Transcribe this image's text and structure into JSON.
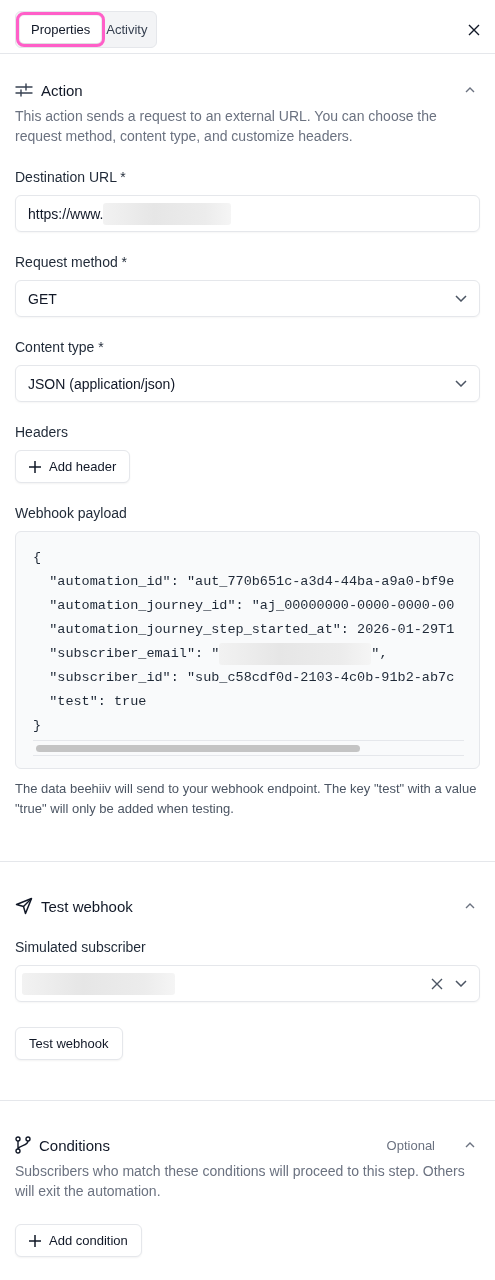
{
  "tabs": [
    {
      "label": "Properties",
      "selected": true,
      "highlighted": true
    },
    {
      "label": "Activity",
      "selected": false,
      "highlighted": false
    }
  ],
  "sections": [
    {
      "kind": "action",
      "title": "Action",
      "expanded": true,
      "description": "This action sends a request to an external URL. You can choose the request method, content type, and customize headers.",
      "fields": [
        {
          "kind": "input",
          "label": "Destination URL *",
          "value": "https://www.",
          "redacted": true
        },
        {
          "kind": "select",
          "label": "Request method *",
          "value": "GET"
        },
        {
          "kind": "select",
          "label": "Content type *",
          "value": "JSON (application/json)"
        },
        {
          "kind": "button",
          "label": "Headers",
          "button": "Add header",
          "plus": true
        },
        {
          "kind": "code",
          "label": "Webhook payload",
          "lines": [
            {
              "kind": "plain",
              "text": "{"
            },
            {
              "kind": "plain",
              "text": "  \"automation_id\": \"aut_770b651c-a3d4-44ba-a9a0-bf9e"
            },
            {
              "kind": "plain",
              "text": "  \"automation_journey_id\": \"aj_00000000-0000-0000-00"
            },
            {
              "kind": "plain",
              "text": "  \"automation_journey_step_started_at\": 2026-01-29T1"
            },
            {
              "kind": "redacted",
              "before": "  \"subscriber_email\": \"",
              "after": "\","
            },
            {
              "kind": "plain",
              "text": "  \"subscriber_id\": \"sub_c58cdf0d-2103-4c0b-91b2-ab7c"
            },
            {
              "kind": "plain",
              "text": "  \"test\": true"
            },
            {
              "kind": "plain",
              "text": "}"
            }
          ],
          "caption": "The data beehiiv will send to your webhook endpoint. The key \"test\" with a value \"true\" will only be added when testing."
        }
      ]
    },
    {
      "kind": "test",
      "title": "Test webhook",
      "expanded": true,
      "fields": [
        {
          "kind": "combo",
          "label": "Simulated subscriber",
          "redacted": true
        },
        {
          "kind": "button",
          "button": "Test webhook"
        }
      ]
    },
    {
      "kind": "conditions",
      "title": "Conditions",
      "badge": "Optional",
      "expanded": true,
      "description": "Subscribers who match these conditions will proceed to this step. Others will exit the automation.",
      "fields": [
        {
          "kind": "button",
          "button": "Add condition",
          "plus": true
        }
      ]
    }
  ]
}
